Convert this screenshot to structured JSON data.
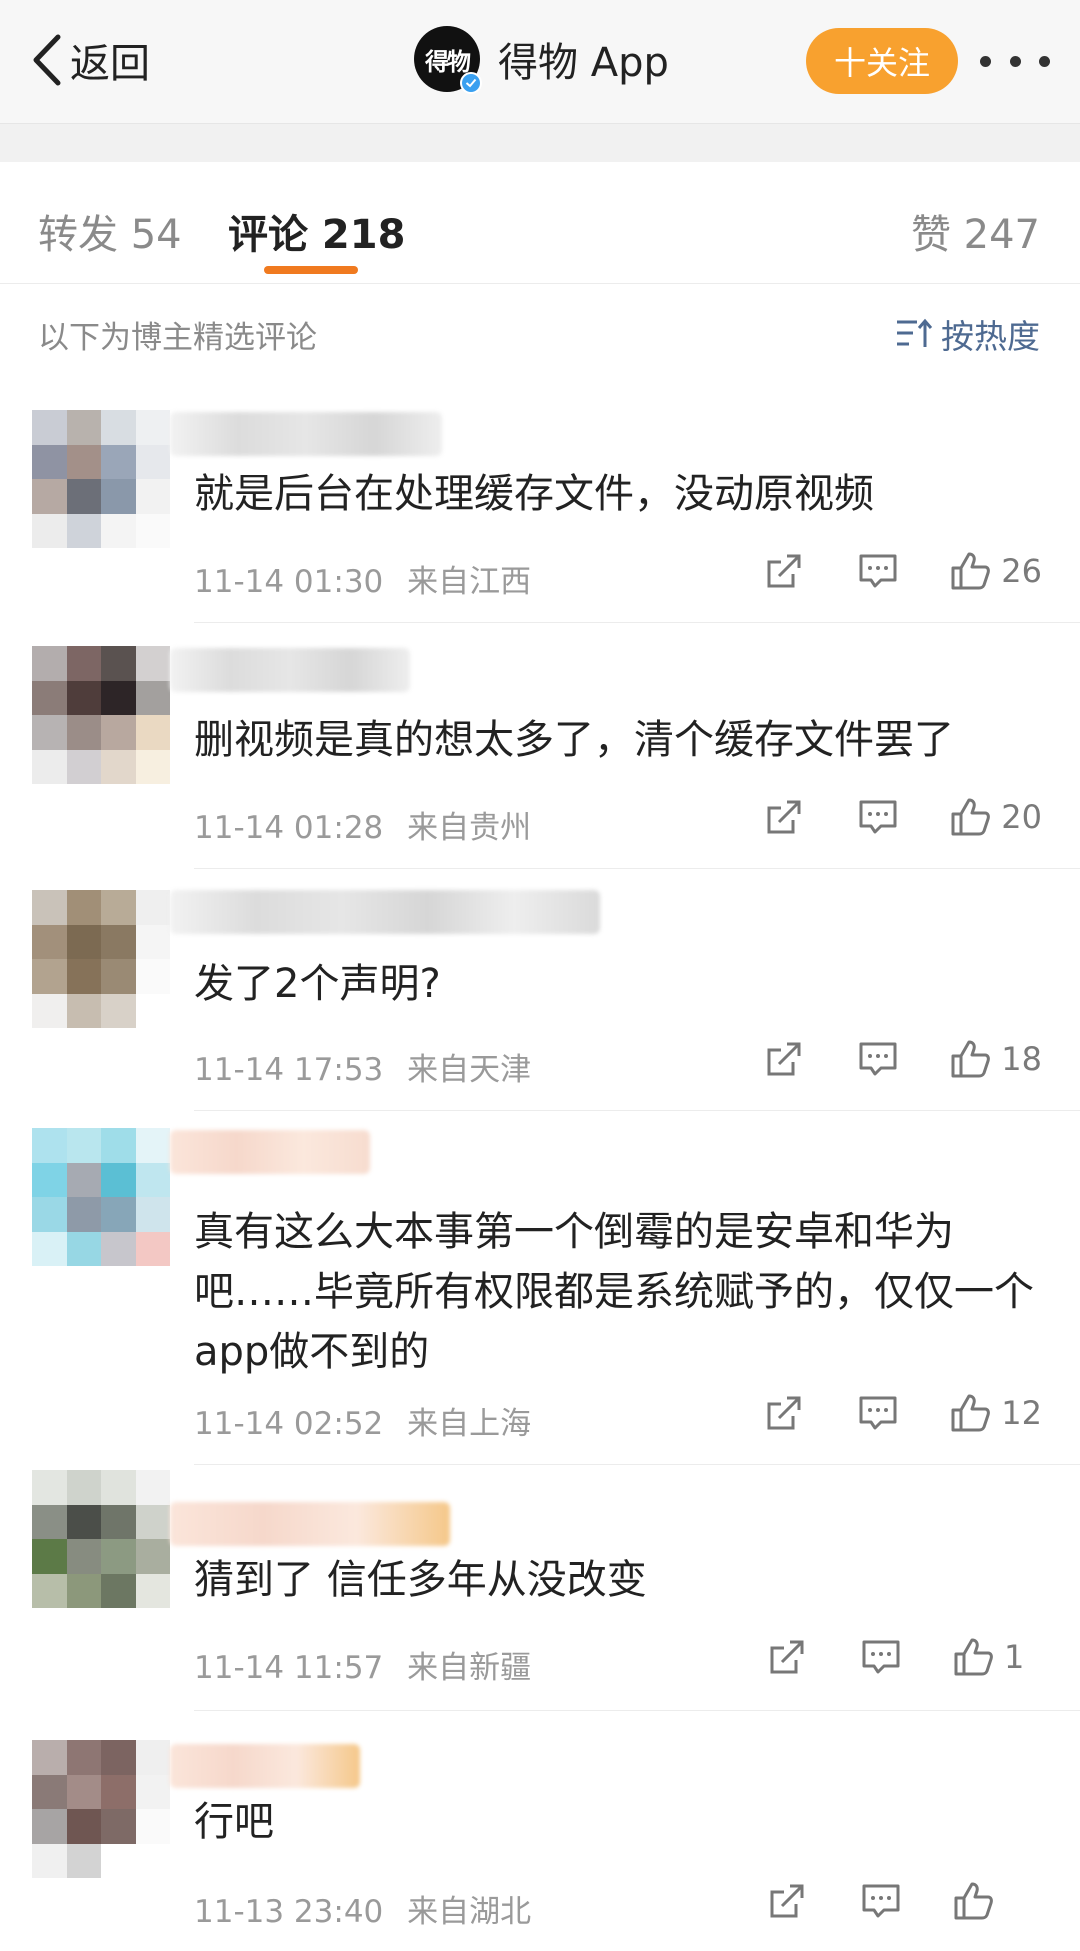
{
  "header": {
    "back_label": "返回",
    "logo_text": "得物",
    "account_name": "得物 App",
    "follow_label": "十关注"
  },
  "tabs": [
    {
      "label": "转发 54"
    },
    {
      "label": "评论 218"
    },
    {
      "label": "赞 247"
    }
  ],
  "section": {
    "title": "以下为博主精选评论",
    "sort_label": "按热度"
  },
  "comments": [
    {
      "text": "就是后台在处理缓存文件，没动原视频",
      "time": "11-14 01:30",
      "location": "来自江西",
      "likes": "26"
    },
    {
      "text": "删视频是真的想太多了，清个缓存文件罢了",
      "time": "11-14 01:28",
      "location": "来自贵州",
      "likes": "20"
    },
    {
      "text": "发了2个声明?",
      "time": "11-14 17:53",
      "location": "来自天津",
      "likes": "18"
    },
    {
      "text": "真有这么大本事第一个倒霉的是安卓和华为吧……毕竟所有权限都是系统赋予的，仅仅一个app做不到的",
      "time": "11-14 02:52",
      "location": "来自上海",
      "likes": "12"
    },
    {
      "text": "猜到了 信任多年从没改变",
      "time": "11-14 11:57",
      "location": "来自新疆",
      "likes": "1"
    },
    {
      "text": "行吧",
      "time": "11-13 23:40",
      "location": "来自湖北",
      "likes": ""
    }
  ],
  "colors": {
    "accent_orange": "#f8a12f",
    "tab_underline": "#f07a1f",
    "sort_blue": "#4e6a91"
  }
}
